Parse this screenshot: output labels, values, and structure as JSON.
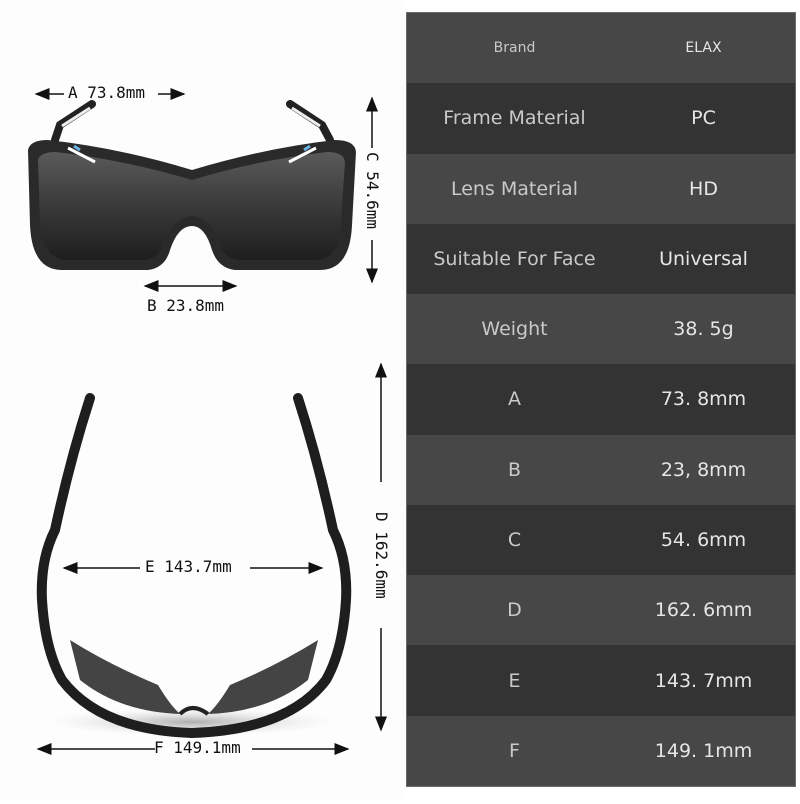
{
  "diagram": {
    "front_view": {
      "dimension_a": "A 73.8mm",
      "dimension_b": "B 23.8mm",
      "dimension_c": "C 54.6mm"
    },
    "top_view": {
      "dimension_d": "D 162.6mm",
      "dimension_e": "E 143.7mm",
      "dimension_f": "F 149.1mm"
    }
  },
  "specs": [
    {
      "label": "Brand",
      "value": "ELAX"
    },
    {
      "label": "Frame Material",
      "value": "PC"
    },
    {
      "label": "Lens Material",
      "value": "HD"
    },
    {
      "label": "Suitable For Face",
      "value": "Universal"
    },
    {
      "label": "Weight",
      "value": "38. 5g"
    },
    {
      "label": "A",
      "value": "73. 8mm"
    },
    {
      "label": "B",
      "value": "23, 8mm"
    },
    {
      "label": "C",
      "value": "54. 6mm"
    },
    {
      "label": "D",
      "value": "162. 6mm"
    },
    {
      "label": "E",
      "value": "143. 7mm"
    },
    {
      "label": "F",
      "value": "149. 1mm"
    }
  ],
  "colors": {
    "row_light": "#474747",
    "row_dark": "#333333",
    "text_label": "#c9c9c9",
    "text_value": "#e6e6e6"
  }
}
